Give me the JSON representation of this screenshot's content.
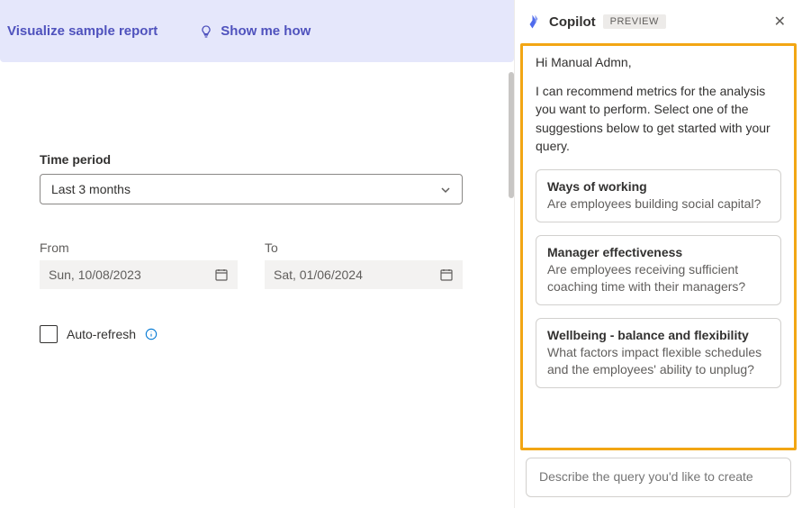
{
  "hero": {
    "visualize_label": "Visualize sample report",
    "show_me_label": "Show me how"
  },
  "form": {
    "time_period_label": "Time period",
    "time_period_value": "Last 3 months",
    "from_label": "From",
    "from_value": "Sun, 10/08/2023",
    "to_label": "To",
    "to_value": "Sat, 01/06/2024",
    "auto_refresh_label": "Auto-refresh"
  },
  "copilot": {
    "title": "Copilot",
    "badge": "PREVIEW",
    "greeting": "Hi Manual Admn,",
    "intro": "I can recommend metrics for the analysis you want to perform. Select one of the suggestions below to get started with your query.",
    "suggestions": [
      {
        "title": "Ways of working",
        "desc": "Are employees building social capital?"
      },
      {
        "title": "Manager effectiveness",
        "desc": "Are employees receiving sufficient coaching time with their managers?"
      },
      {
        "title": "Wellbeing - balance and flexibility",
        "desc": "What factors impact flexible schedules and the employees' ability to unplug?"
      }
    ],
    "input_placeholder": "Describe the query you'd like to create"
  }
}
